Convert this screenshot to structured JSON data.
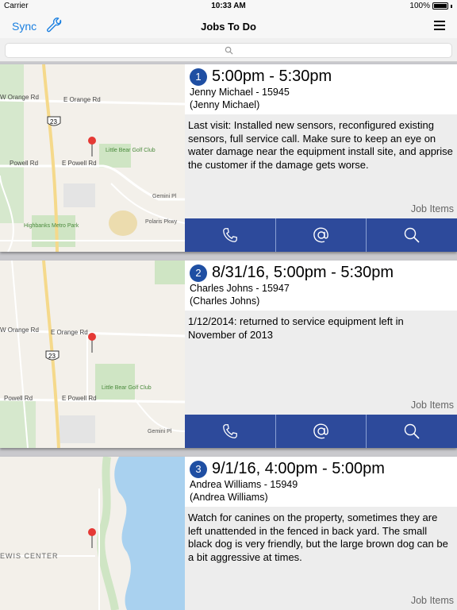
{
  "status": {
    "carrier": "Carrier",
    "time": "10:33 AM",
    "battery": "100%"
  },
  "nav": {
    "sync_label": "Sync",
    "title": "Jobs To Do"
  },
  "search": {
    "placeholder": ""
  },
  "jobs": [
    {
      "number": "1",
      "time": "5:00pm - 5:30pm",
      "customer": "Jenny Michael - 15945",
      "contact": "(Jenny Michael)",
      "notes": "Last visit: Installed new sensors, reconfigured existing sensors, full service call. Make sure to keep an eye on water damage near the equipment install site, and apprise the customer if the damage gets worse.",
      "job_items_label": "Job Items",
      "map_labels": {
        "road1": "W Orange Rd",
        "road2": "E Orange Rd",
        "road3": "Powell Rd",
        "road4": "E Powell Rd",
        "route": "23",
        "golf": "Little Bear Golf Club",
        "park": "Highbanks Metro Park",
        "gemini": "Gemini Pl",
        "polaris": "Polaris Pkwy"
      }
    },
    {
      "number": "2",
      "time": "8/31/16, 5:00pm - 5:30pm",
      "customer": "Charles Johns - 15947",
      "contact": "(Charles Johns)",
      "notes": "1/12/2014: returned to service equipment left in November of 2013",
      "job_items_label": "Job Items",
      "map_labels": {
        "road1": "W Orange Rd",
        "road2": "E Orange Rd",
        "road3": "Powell Rd",
        "road4": "E Powell Rd",
        "route": "23",
        "golf": "Little Bear Golf Club",
        "gemini": "Gemini Pl"
      }
    },
    {
      "number": "3",
      "time": "9/1/16, 4:00pm - 5:00pm",
      "customer": "Andrea Williams - 15949",
      "contact": "(Andrea Williams)",
      "notes": "Watch for canines on the property, sometimes they are left unattended in the fenced in back yard. The small black dog is very friendly, but the large brown dog can be a bit aggressive at times.",
      "job_items_label": "Job Items",
      "map_labels": {
        "center": "EWIS CENTER"
      }
    }
  ],
  "icons": {
    "phone": "phone-icon",
    "email": "at-sign-icon",
    "search": "magnifier-icon",
    "wrench": "wrench-icon",
    "menu": "hamburger-menu-icon"
  },
  "colors": {
    "accent": "#1a7fe0",
    "action_bar": "#2d4a9b",
    "badge": "#1f4fa3"
  }
}
